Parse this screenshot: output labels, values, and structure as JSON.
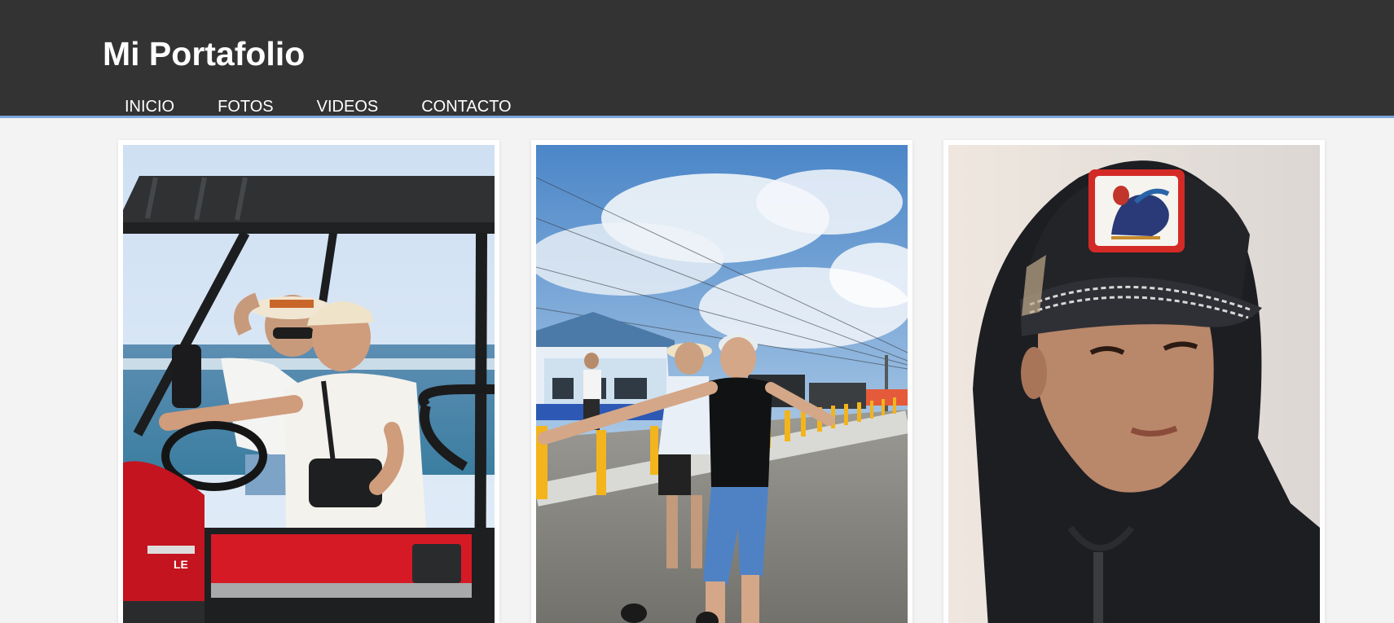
{
  "header": {
    "title": "Mi Portafolio",
    "nav": [
      {
        "label": "INICIO"
      },
      {
        "label": "FOTOS"
      },
      {
        "label": "VIDEOS"
      },
      {
        "label": "CONTACTO"
      }
    ]
  },
  "gallery": {
    "photos": [
      {
        "subject": "two people in a red UTV by the sea"
      },
      {
        "subject": "two people posing on a seaside street under a cloudy sky"
      },
      {
        "subject": "portrait of a young man in a hoodie and rooster patch cap"
      }
    ]
  },
  "colors": {
    "header_bg": "#333333",
    "header_border": "#7aa6dc",
    "page_bg": "#f3f3f3",
    "card_bg": "#ffffff"
  }
}
